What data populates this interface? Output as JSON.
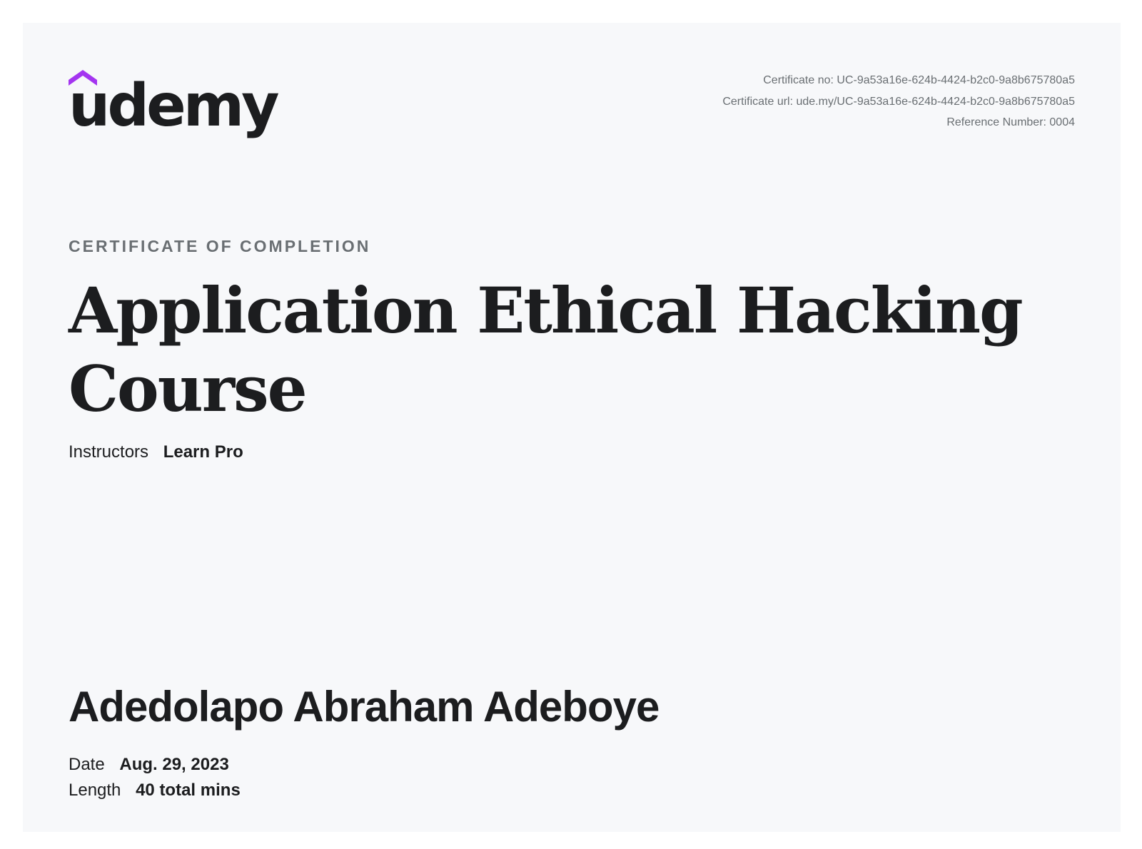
{
  "brand": {
    "logo_text": "udemy",
    "colors": {
      "hat": "#a435f0",
      "text": "#1c1d1f",
      "muted": "#6a6f73",
      "background": "#f7f8fa"
    }
  },
  "certificate": {
    "number": "Certificate no: UC-9a53a16e-624b-4424-b2c0-9a8b675780a5",
    "url": "Certificate url: ude.my/UC-9a53a16e-624b-4424-b2c0-9a8b675780a5",
    "reference": "Reference Number: 0004",
    "eyebrow": "CERTIFICATE OF COMPLETION",
    "course_title": "Application Ethical Hacking Course",
    "instructors_label": "Instructors",
    "instructors_value": "Learn Pro",
    "recipient_name": "Adedolapo Abraham Adeboye",
    "date_label": "Date",
    "date_value": "Aug. 29, 2023",
    "length_label": "Length",
    "length_value": "40 total mins"
  }
}
